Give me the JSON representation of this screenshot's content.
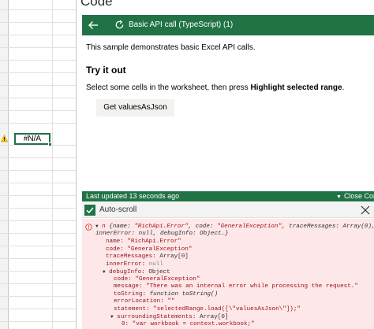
{
  "pane": {
    "title": "Code",
    "sample_title": "Basic API call (TypeScript) (1)",
    "description": "This sample demonstrates basic Excel API calls.",
    "try_heading": "Try it out",
    "instructions_prefix": "Select some cells in the worksheet, then press ",
    "instructions_bold": "Highlight selected range",
    "instructions_suffix": ".",
    "button_label": "Get valuesAsJson"
  },
  "sheet": {
    "cell_value": "#N/A"
  },
  "status": {
    "last_updated": "Last updated 13 seconds ago",
    "close_label": "Close Cor"
  },
  "console": {
    "autoscroll_label": "Auto-scroll",
    "lines": {
      "l1_name": "n",
      "l1_a": " {name: ",
      "l1_b": "\"RichApi.Error\"",
      "l1_c": ", code: ",
      "l1_d": "\"GeneralException\"",
      "l1_e": ", traceMessages: Array(0),",
      "l2": "innerError: null, debugInfo: Object…}",
      "l3_k": "name: ",
      "l3_v": "\"RichApi.Error\"",
      "l4_k": "code: ",
      "l4_v": "\"GeneralException\"",
      "l5_k": "traceMessages: ",
      "l5_v": "Array[0]",
      "l6_k": "innerError: ",
      "l6_v": "null",
      "l7_k": "debugInfo: ",
      "l7_v": "Object",
      "l8_k": "code: ",
      "l8_v": "\"GeneralException\"",
      "l9_k": "message: ",
      "l9_v": "\"There was an internal error while processing the request.\"",
      "l10_k": "toString: ",
      "l10_v": "function toString()",
      "l11_k": "errorLocation: ",
      "l11_v": "\"\"",
      "l12_k": "statement: ",
      "l12_v": "\"selectedRange.load([\\\"valuesAsJson\\\"]);\"",
      "l13_k": "surroundingStatements: ",
      "l13_v": "Array[0]",
      "l14_k": "0: ",
      "l14_v": "\"var workbook = context.workbook;\""
    }
  },
  "icons": {
    "back": "arrow-left-icon",
    "refresh": "refresh-icon",
    "warning": "warning-icon",
    "error": "error-circle-icon",
    "check": "checkmark-icon",
    "close": "close-icon"
  },
  "colors": {
    "excel_green": "#217346",
    "console_bg": "#fde7e9",
    "button_bg": "#f3f2f1"
  }
}
